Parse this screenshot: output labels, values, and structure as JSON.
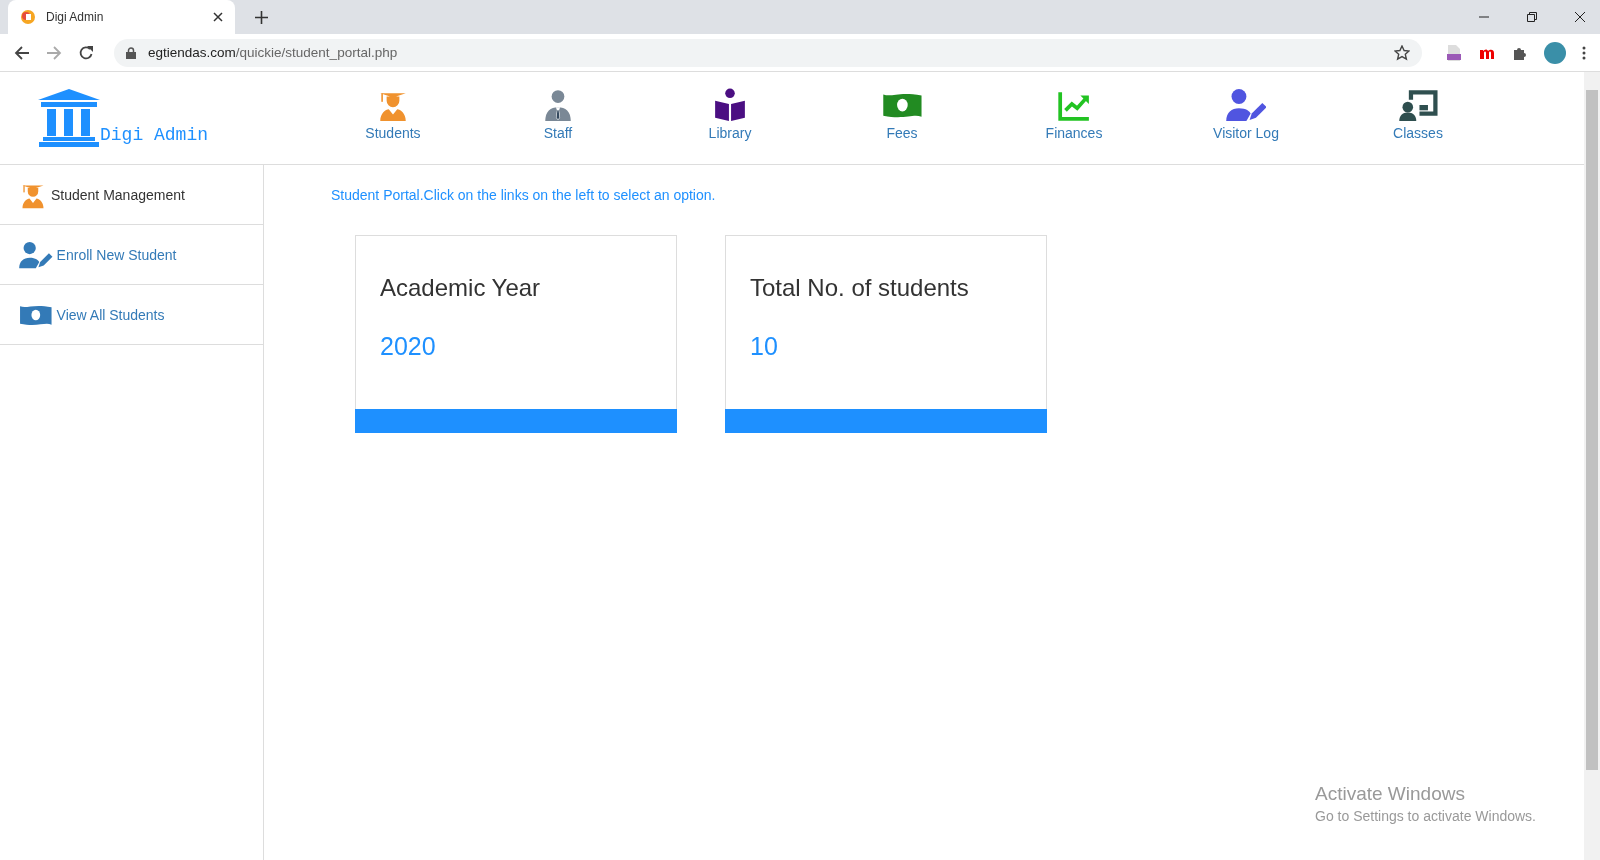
{
  "browser": {
    "tab_title": "Digi Admin",
    "url_domain": "egtiendas.com",
    "url_path": "/quickie/student_portal.php"
  },
  "brand": {
    "name": "Digi Admin"
  },
  "nav": [
    {
      "label": "Students",
      "kind": "graduate",
      "color": "#f0922e"
    },
    {
      "label": "Staff",
      "kind": "staff",
      "color": "#7a8896"
    },
    {
      "label": "Library",
      "kind": "book",
      "color": "#4b0f82"
    },
    {
      "label": "Fees",
      "kind": "money",
      "color": "#228b22"
    },
    {
      "label": "Finances",
      "kind": "chart",
      "color": "#22c322"
    },
    {
      "label": "Visitor Log",
      "kind": "user-edit",
      "color": "#5055e0"
    },
    {
      "label": "Classes",
      "kind": "teacher",
      "color": "#2f4f4f"
    }
  ],
  "sidebar": {
    "items": [
      {
        "label": "Student Management",
        "kind": "graduate",
        "selected": true
      },
      {
        "label": "Enroll New Student",
        "kind": "user-edit",
        "selected": false
      },
      {
        "label": "View All Students",
        "kind": "money",
        "selected": false
      }
    ]
  },
  "message": "Student Portal.Click on the links on the left to select an option.",
  "cards": [
    {
      "title": "Academic Year",
      "value": "2020"
    },
    {
      "title": "Total No. of students",
      "value": "10"
    }
  ],
  "os_watermark": {
    "title": "Activate Windows",
    "subtitle": "Go to Settings to activate Windows."
  }
}
